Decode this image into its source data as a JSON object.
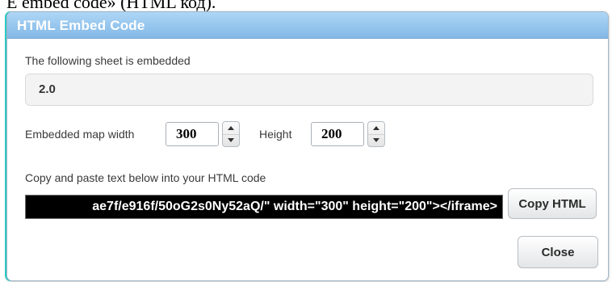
{
  "caption_fragment": "Е embed code» (HTML код).",
  "dialog": {
    "title": "HTML Embed Code",
    "sheet_label": "The following sheet is embedded",
    "sheet_name": "2.0",
    "width_label": "Embedded map width",
    "width_value": "300",
    "height_label": "Height",
    "height_value": "200",
    "code_label": "Copy and paste text below into your HTML code",
    "code_value": "ae7f/e916f/50oG2s0Ny52aQ/\" width=\"300\" height=\"200\"></iframe>",
    "copy_button": "Copy HTML",
    "close_button": "Close"
  },
  "colors": {
    "titlebar": "#82b8e6",
    "code_field_bg": "#000000",
    "accent_edge": "#2cc9c5"
  },
  "icons": [
    "spinner-up-icon",
    "spinner-down-icon"
  ]
}
